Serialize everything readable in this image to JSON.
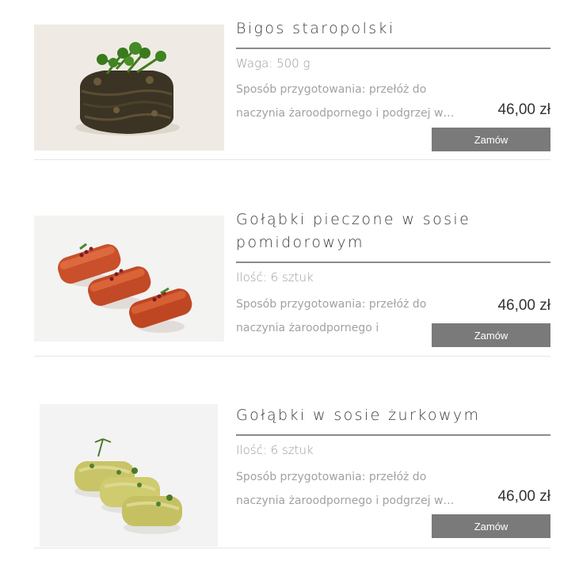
{
  "products": [
    {
      "title": "Bigos staropolski",
      "weight": "Waga: 500 g",
      "description": "Sposób przygotowania: przełóż do naczynia żaroodpornego i podgrzej w…",
      "price": "46,00 zł",
      "order_label": "Zamów",
      "image_icon": "bigos-dish-image"
    },
    {
      "title": "Gołąbki pieczone w sosie pomidorowym",
      "weight": "Ilość: 6 sztuk",
      "description": "Sposób przygotowania: przełóż do naczynia żaroodpornego i podgrzej w…",
      "price": "46,00 zł",
      "order_label": "Zamów",
      "image_icon": "tomato-cabbage-rolls-image"
    },
    {
      "title": "Gołąbki w sosie żurkowym",
      "weight": "Ilość: 6 sztuk",
      "description": "Sposób przygotowania: przełóż do naczynia żaroodpornego i podgrzej w…",
      "price": "46,00 zł",
      "order_label": "Zamów",
      "image_icon": "zurek-cabbage-rolls-image"
    }
  ],
  "colors": {
    "button_bg": "#7a7a7a",
    "rule": "#8a8a8a",
    "muted_text": "#a2a2a2"
  }
}
